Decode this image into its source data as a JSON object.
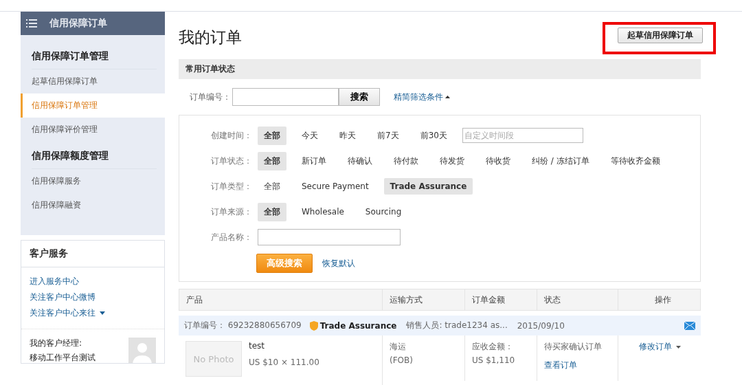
{
  "sidebar": {
    "title": "信用保障订单",
    "sections": [
      {
        "heading": "信用保障订单管理",
        "items": [
          {
            "label": "起草信用保障订单",
            "selected": false
          },
          {
            "label": "信用保障订单管理",
            "selected": true
          },
          {
            "label": "信用保障评价管理",
            "selected": false
          }
        ]
      },
      {
        "heading": "信用保障额度管理",
        "items": [
          {
            "label": "信用保障服务",
            "selected": false
          },
          {
            "label": "信用保障融资",
            "selected": false
          }
        ]
      }
    ]
  },
  "customer_service": {
    "title": "客户服务",
    "links": [
      "进入服务中心",
      "关注客户中心微博",
      "关注客户中心来往"
    ],
    "manager_label": "我的客户经理:",
    "manager_name": "移动工作平台测试"
  },
  "page_title": "我的订单",
  "create_button": {
    "label": "起草信用保障订单",
    "highlighted": true
  },
  "status_bar": "常用订单状态",
  "search": {
    "label": "订单编号：",
    "button": "搜索",
    "toggle": "精简筛选条件"
  },
  "filters": [
    {
      "label": "创建时间：",
      "options": [
        {
          "label": "全部",
          "selected": true
        },
        {
          "label": "今天",
          "selected": false
        },
        {
          "label": "昨天",
          "selected": false
        },
        {
          "label": "前7天",
          "selected": false
        },
        {
          "label": "前30天",
          "selected": false
        }
      ],
      "placeholder": "自定义时间段"
    },
    {
      "label": "订单状态：",
      "options": [
        {
          "label": "全部",
          "selected": true
        },
        {
          "label": "新订单",
          "selected": false
        },
        {
          "label": "待确认",
          "selected": false
        },
        {
          "label": "待付款",
          "selected": false
        },
        {
          "label": "待发货",
          "selected": false
        },
        {
          "label": "待收货",
          "selected": false
        },
        {
          "label": "纠纷 / 冻结订单",
          "selected": false
        },
        {
          "label": "等待收齐金额",
          "selected": false
        }
      ]
    },
    {
      "label": "订单类型：",
      "options": [
        {
          "label": "全部",
          "selected": false
        },
        {
          "label": "Secure Payment",
          "selected": false
        },
        {
          "label": "Trade Assurance",
          "selected": true
        }
      ]
    },
    {
      "label": "订单来源：",
      "options": [
        {
          "label": "全部",
          "selected": true
        },
        {
          "label": "Wholesale",
          "selected": false
        },
        {
          "label": "Sourcing",
          "selected": false
        }
      ]
    }
  ],
  "product_name": {
    "label": "产品名称："
  },
  "advanced_search": "高级搜索",
  "reset": "恢复默认",
  "table": {
    "columns": [
      "产品",
      "运输方式",
      "订单金额",
      "状态",
      "操作"
    ],
    "order": {
      "number_label": "订单编号：",
      "number": "69232880656709",
      "badge": "Trade Assurance",
      "seller": "销售人员: trade1234 as...",
      "date": "2015/09/10",
      "photo": "No Photo",
      "product": "test",
      "price": "US $10 × 111.00",
      "shipping": "海运",
      "shipping_term": "(FOB)",
      "amount_label": "应收金额：",
      "amount": "US $1,110",
      "status": "待买家确认订单",
      "view": "查看订单",
      "action": "修改订单"
    }
  }
}
